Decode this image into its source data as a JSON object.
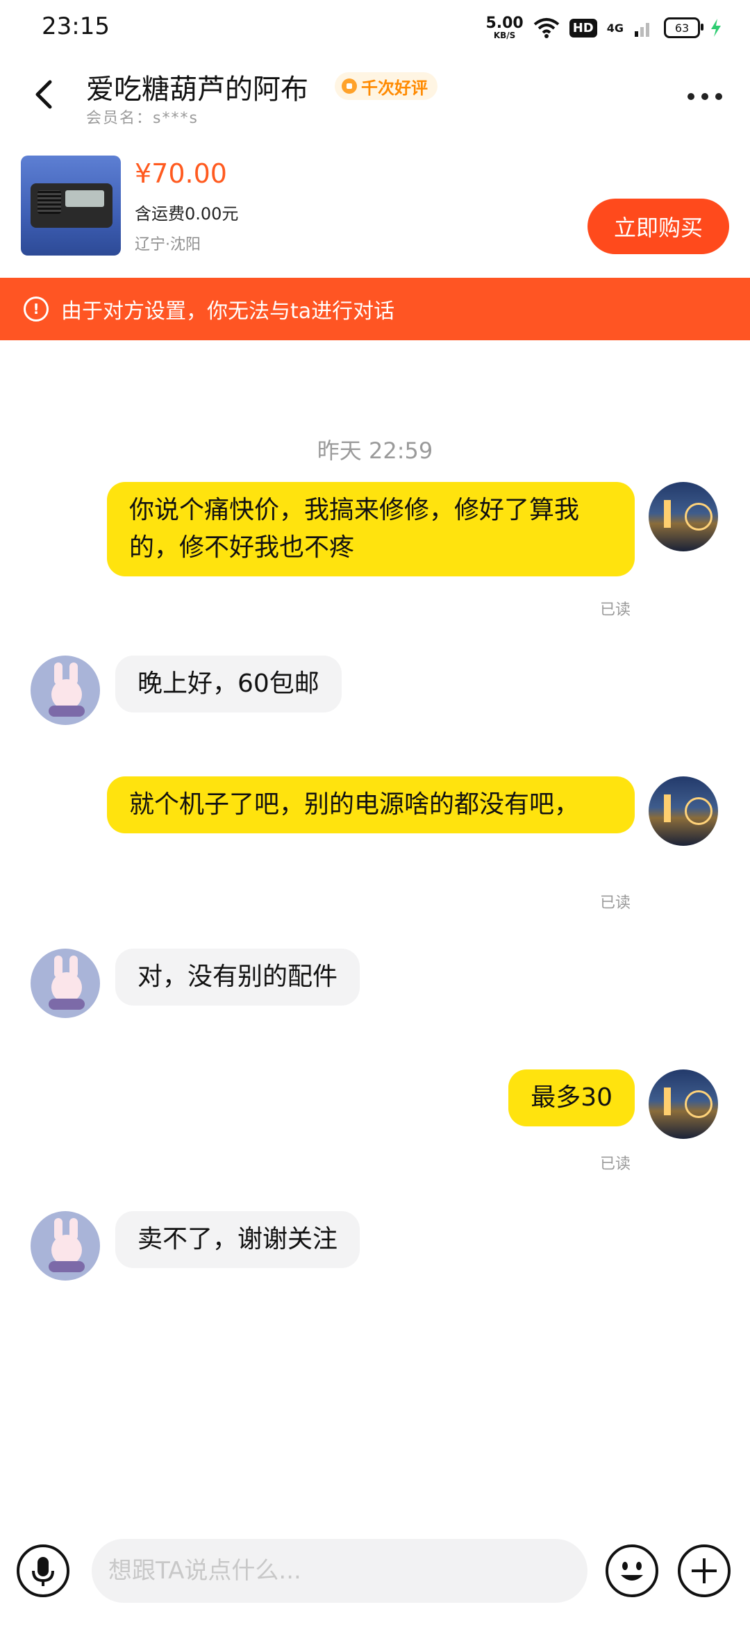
{
  "status_bar": {
    "time": "23:15",
    "speed_value": "5.00",
    "speed_unit": "KB/S",
    "hd": "HD",
    "network": "4G",
    "battery": "63"
  },
  "header": {
    "title": "爱吃糖葫芦的阿布",
    "badge": "千次好评",
    "member_label": "会员名：s***s"
  },
  "product": {
    "price": "¥70.00",
    "shipping": "含运费0.00元",
    "location": "辽宁·沈阳",
    "buy_label": "立即购买"
  },
  "banner": {
    "text": "由于对方设置，你无法与ta进行对话"
  },
  "chat": {
    "timestamp": "昨天 22:59",
    "read_label": "已读",
    "messages": [
      {
        "from": "me",
        "text": "你说个痛快价，我搞来修修，修好了算我的，修不好我也不疼"
      },
      {
        "from": "them",
        "text": "晚上好，60包邮"
      },
      {
        "from": "me",
        "text": "就个机子了吧，别的电源啥的都没有吧，"
      },
      {
        "from": "them",
        "text": "对，没有别的配件"
      },
      {
        "from": "me",
        "text": "最多30"
      },
      {
        "from": "them",
        "text": "卖不了，谢谢关注"
      }
    ]
  },
  "input_bar": {
    "placeholder": "想跟TA说点什么..."
  },
  "icons": {
    "back": "chevron-left-icon",
    "more": "more-dots-icon",
    "warning": "alert-circle-icon",
    "mic": "microphone-icon",
    "emoji": "smile-icon",
    "plus": "plus-circle-icon"
  },
  "colors": {
    "accent": "#ff4a1c",
    "banner": "#ff5523",
    "my_bubble": "#ffe30e",
    "their_bubble": "#f3f3f4"
  }
}
